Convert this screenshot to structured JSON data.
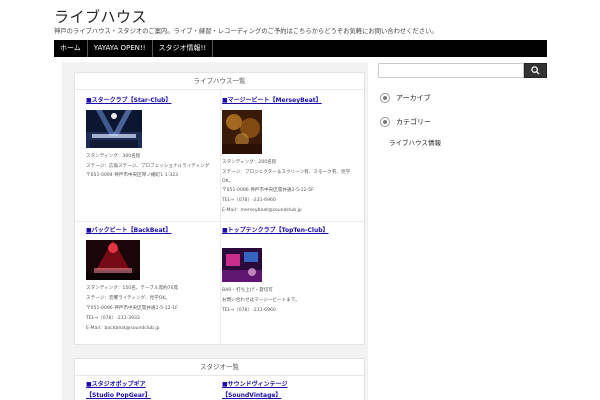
{
  "site": {
    "title": "ライブハウス",
    "description": "神戸のライブハウス・スタジオのご案内。ライブ・練習・レコーディングのご予約はこちらからどうぞお気軽にお問い合わせください。"
  },
  "nav": {
    "items": [
      "ホーム",
      "YAYAYA OPEN!!",
      "スタジオ情報!!"
    ]
  },
  "live_box": {
    "title": "ライブハウス一覧",
    "venues": [
      {
        "title": "■スタークラブ【Star-Club】",
        "lines": [
          "スタンディング：300名程",
          "ステージ：広角ステージ、プロフェッショナルライティング",
          "〒651-0094 神戸市中央区琴ノ緒町1-1-323"
        ]
      },
      {
        "title": "■マージービート【MerseyBeat】",
        "lines": [
          "スタンディング：200名程",
          "ステージ：プロジェクター＆スクリーン有、スモーク有、見学OK。",
          "〒651-0096 神戸市中央区雲井通2-5-12-5F",
          "TEL→（078）-231-6960",
          "E-Mail：merseybeat@soundclub.jp"
        ]
      },
      {
        "title": "■バックビート【BackBeat】",
        "lines": [
          "スタンディング：150名、テーブル席約70席",
          "ステージ：音響ライティング、見学OK。",
          "〒651-0096 神戸市中央区雲井通2-5-12-1F",
          "TEL→（078）-231-3933",
          "E-Mail：backbeat@soundclub.jp"
        ]
      },
      {
        "title": "■トップテンクラブ【TopTen-Club】",
        "lines": [
          "BAR・打ち上げ・貸切可",
          "お問い合わせはマージービートまで。",
          "TEL→（078）-231-6960"
        ]
      }
    ]
  },
  "studio_box": {
    "title": "スタジオ一覧",
    "left_links": [
      "■スタジオポップギア",
      "【Studio PopGear】"
    ],
    "right_links": [
      "■サウンドヴィンテージ",
      "【SoundVintage】"
    ]
  },
  "sidebar": {
    "search_placeholder": "",
    "items": [
      "アーカイブ",
      "カテゴリー"
    ],
    "sub_item": "ライブハウス情報"
  },
  "colors": {
    "nav_bg": "#000000",
    "link": "#1a0dab",
    "main_bg": "#f2f2f2"
  }
}
